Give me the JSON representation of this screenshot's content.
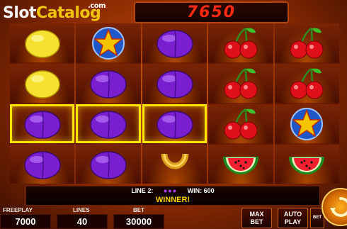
{
  "logo": {
    "part1": "Slot",
    "part2": "Catalog",
    "suffix": ".com"
  },
  "credit": "7650",
  "reels": [
    [
      "lemon",
      "lemon",
      "plum",
      "plum"
    ],
    [
      "star",
      "plum",
      "plum",
      "plum"
    ],
    [
      "plum",
      "plum",
      "plum",
      "horseshoe"
    ],
    [
      "cherry",
      "cherry",
      "cherry",
      "watermelon"
    ],
    [
      "cherry",
      "cherry",
      "star",
      "watermelon"
    ]
  ],
  "winning_cells": [
    [
      0,
      2
    ],
    [
      1,
      2
    ],
    [
      2,
      2
    ]
  ],
  "win": {
    "line_label": "LINE 2:",
    "symbols": "●●●",
    "win_label": "WIN: 600",
    "message": "WINNER!"
  },
  "freeplay": {
    "label": "FREEPLAY",
    "value": "7000"
  },
  "lines": {
    "label": "LINES",
    "value": "40"
  },
  "bet": {
    "label": "BET",
    "value": "30000"
  },
  "buttons": {
    "max_bet_1": "MAX",
    "max_bet_2": "BET",
    "auto_play_1": "AUTO",
    "auto_play_2": "PLAY",
    "bet_small": "BET"
  },
  "colors": {
    "credit": "#ff2a12",
    "highlight": "#ffe600",
    "winner": "#ffd400"
  }
}
